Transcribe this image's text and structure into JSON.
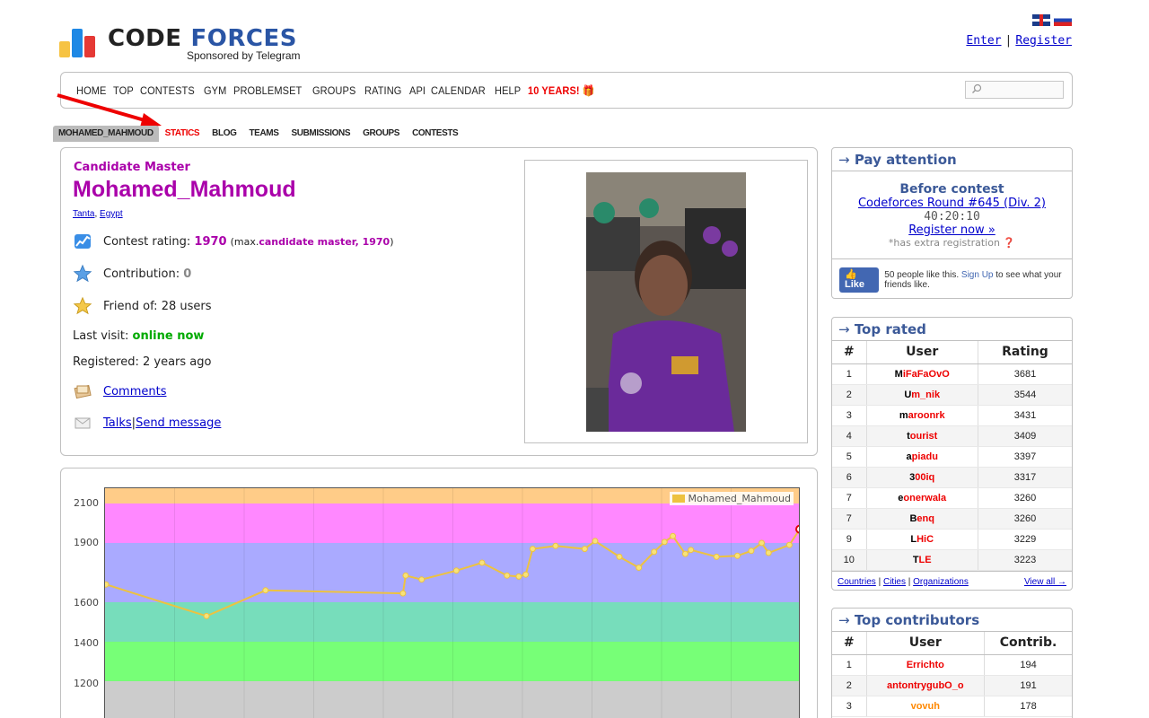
{
  "header": {
    "logo_word1": "CODE",
    "logo_word2": "FORCES",
    "sponsor": "Sponsored by Telegram",
    "enter": "Enter",
    "separator": "|",
    "register": "Register"
  },
  "menu": {
    "items": [
      "HOME",
      "TOP",
      "CONTESTS",
      "GYM",
      "PROBLEMSET",
      "GROUPS",
      "RATING",
      "API",
      "CALENDAR",
      "HELP"
    ],
    "special": "10 YEARS! 🎁",
    "search_value": ""
  },
  "submenu": {
    "items": [
      "MOHAMED_MAHMOUD",
      "STATICS",
      "BLOG",
      "TEAMS",
      "SUBMISSIONS",
      "GROUPS",
      "CONTESTS"
    ]
  },
  "profile": {
    "rank": "Candidate Master",
    "handle": "Mohamed_Mahmoud",
    "city": "Tanta",
    "country": "Egypt",
    "comma": ", ",
    "rating_label": "Contest rating: ",
    "rating": "1970",
    "rating_max_open": "(max. ",
    "rating_max_rank": "candidate master, 1970",
    "rating_max_close": ")",
    "contribution_label": "Contribution: ",
    "contribution": "0",
    "friends": "Friend of: 28 users",
    "last_visit_label": "Last visit: ",
    "last_visit": "online now",
    "registered": "Registered: 2 years ago",
    "comments": "Comments",
    "talks": "Talks",
    "pipe": " | ",
    "send_message": "Send message"
  },
  "graph": {
    "legend": "Mohamed_Mahmoud",
    "yticks": [
      "2100",
      "1900",
      "1600",
      "1400",
      "1200"
    ],
    "bands": [
      {
        "from": 2100,
        "to": 2300,
        "color": "#ffcc88"
      },
      {
        "from": 1900,
        "to": 2100,
        "color": "#ff88ff"
      },
      {
        "from": 1600,
        "to": 1900,
        "color": "#aaaaff"
      },
      {
        "from": 1400,
        "to": 1600,
        "color": "#77ddbb"
      },
      {
        "from": 1200,
        "to": 1400,
        "color": "#77ff77"
      },
      {
        "from": 1000,
        "to": 1200,
        "color": "#cccccc"
      }
    ],
    "line_color": "#edc240",
    "highlight_color": "#e00000",
    "ratings": [
      1690,
      1530,
      1660,
      1645,
      1735,
      1715,
      1760,
      1800,
      1735,
      1730,
      1740,
      1870,
      1885,
      1870,
      1910,
      1830,
      1775,
      1855,
      1905,
      1935,
      1845,
      1865,
      1830,
      1835,
      1860,
      1900,
      1850,
      1890,
      1970
    ]
  },
  "pay_attention": {
    "title": "Pay attention",
    "arrow": "→",
    "before": "Before contest",
    "round": "Codeforces Round #645 (Div. 2)",
    "timer": "40:20:10",
    "register": "Register now »",
    "note": "*has extra registration",
    "like": "Like",
    "fb_text1": "50 people like this. ",
    "fb_signup": "Sign Up",
    "fb_text2": " to see what your friends like."
  },
  "top_rated": {
    "title": "Top rated",
    "arrow": "→",
    "headers": [
      "#",
      "User",
      "Rating"
    ],
    "rows": [
      {
        "n": "1",
        "first": "M",
        "rest": "iFaFaOvO",
        "v": "3681"
      },
      {
        "n": "2",
        "first": "U",
        "rest": "m_nik",
        "v": "3544"
      },
      {
        "n": "3",
        "first": "m",
        "rest": "aroonrk",
        "v": "3431"
      },
      {
        "n": "4",
        "first": "t",
        "rest": "ourist",
        "v": "3409"
      },
      {
        "n": "5",
        "first": "a",
        "rest": "piadu",
        "v": "3397"
      },
      {
        "n": "6",
        "first": "3",
        "rest": "00iq",
        "v": "3317"
      },
      {
        "n": "7",
        "first": "e",
        "rest": "onerwala",
        "v": "3260"
      },
      {
        "n": "7",
        "first": "B",
        "rest": "enq",
        "v": "3260"
      },
      {
        "n": "9",
        "first": "L",
        "rest": "HiC",
        "v": "3229"
      },
      {
        "n": "10",
        "first": "T",
        "rest": "LE",
        "v": "3223"
      }
    ],
    "footer_links": [
      "Countries",
      "Cities",
      "Organizations"
    ],
    "view_all": "View all →"
  },
  "top_contrib": {
    "title": "Top contributors",
    "arrow": "→",
    "headers": [
      "#",
      "User",
      "Contrib."
    ],
    "rows": [
      {
        "n": "1",
        "user": "Errichto",
        "v": "194",
        "cls": "u-red"
      },
      {
        "n": "2",
        "user": "antontrygubO_o",
        "v": "191",
        "cls": "u-red"
      },
      {
        "n": "3",
        "user": "vovuh",
        "v": "178",
        "cls": "u-orange"
      }
    ]
  }
}
